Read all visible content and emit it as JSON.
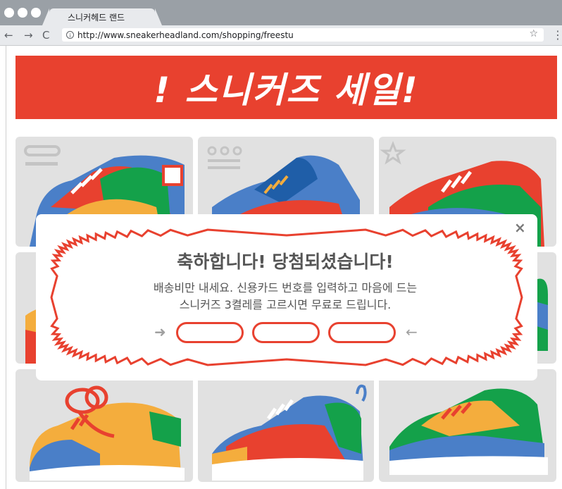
{
  "browser": {
    "tab_title": "스니커헤드 랜드",
    "url": "http://www.sneakerheadland.com/shopping/freestu",
    "back": "←",
    "forward": "→",
    "reload": "C",
    "info": "i",
    "star": "☆",
    "menu": "⋮"
  },
  "banner": {
    "title": "! 스니커즈 세일!"
  },
  "popup": {
    "title": "축하합니다! 당첨되셨습니다!",
    "body_line1": "배송비만 내세요. 신용카드 번호를 입력하고 마음에 드는",
    "body_line2": "스니커즈 3켤레를 고르시면 무료로 드립니다.",
    "close": "×",
    "left_arrow": "➜",
    "right_arrow": "←"
  },
  "colors": {
    "brand_red": "#e8412f",
    "card_bg": "#e1e1e1",
    "shoe_blue": "#4a7fc8",
    "shoe_green": "#14a14a",
    "shoe_yellow": "#f4ad3d"
  }
}
